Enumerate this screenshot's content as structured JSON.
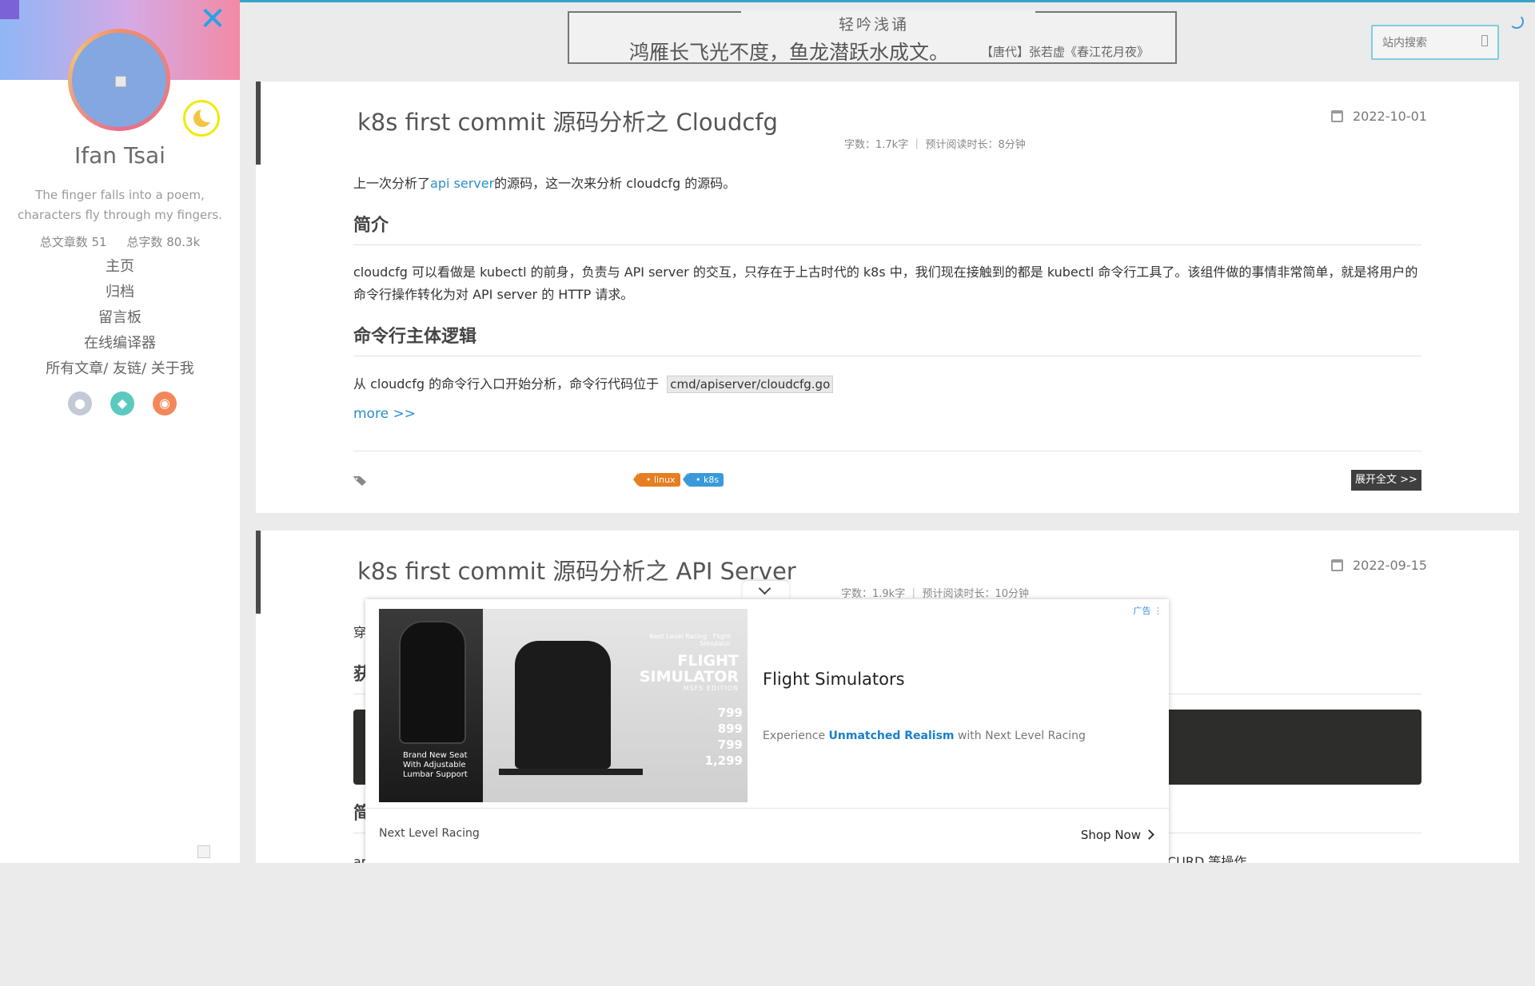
{
  "sidebar": {
    "author": "Ifan Tsai",
    "motto": "The finger falls into a poem, characters fly through my fingers.",
    "stats": {
      "articles_label": "总文章数",
      "articles_value": "51",
      "words_label": "总字数",
      "words_value": "80.3k"
    },
    "nav": [
      "主页",
      "归档",
      "留言板",
      "在线编译器",
      "所有文章/ 友链/ 关于我"
    ],
    "socials": [
      "github-icon",
      "qq-icon",
      "rss-icon"
    ],
    "colors": {
      "banner_start": "#8fb6f5",
      "banner_end": "#f28aa5",
      "close": "#23a4e6",
      "moon_ring": "#f4e80a"
    }
  },
  "poem": {
    "title": "轻吟浅诵",
    "line": "鸿雁长飞光不度，鱼龙潜跃水成文。",
    "source": "【唐代】张若虚《春江花月夜》"
  },
  "search": {
    "placeholder": "站内搜索"
  },
  "posts": [
    {
      "title": "k8s first commit 源码分析之 Cloudcfg",
      "date": "2022-10-01",
      "meta": "字数：1.7k字 ｜ 预计阅读时长：8分钟",
      "intro_before": "上一次分析了",
      "intro_link": "api server",
      "intro_after": "的源码，这一次来分析 cloudcfg 的源码。",
      "h_intro": "简介",
      "p_intro": "cloudcfg 可以看做是 kubectl 的前身，负责与 API server 的交互，只存在于上古时代的 k8s 中，我们现在接触到的都是 kubectl 命令行工具了。该组件做的事情非常简单，就是将用户的命令行操作转化为对 API server 的 HTTP 请求。",
      "h_cli": "命令行主体逻辑",
      "p_cli": "从 cloudcfg 的命令行入口开始分析，命令行代码位于",
      "code_path": "cmd/apiserver/cloudcfg.go",
      "more": "more >>",
      "tags": [
        "linux",
        "k8s"
      ],
      "expand": "展开全文 >>"
    },
    {
      "title": "k8s first commit 源码分析之 API Server",
      "date": "2022-09-15",
      "meta": "字数：1.9k字 ｜ 预计阅读时长：10分钟",
      "line1_start": "穿",
      "h1_start": "获",
      "h2_start": "简",
      "line_bottom_start": "ar",
      "line_bottom_end": "CURD 等操作"
    }
  ],
  "ad": {
    "label": "广告",
    "title": "Flight Simulators",
    "desc_before": "Experience ",
    "desc_bold": "Unmatched Realism",
    "desc_after": " with Next Level Racing",
    "advertiser": "Next Level Racing",
    "cta": "Shop Now",
    "image": {
      "left_text_1": "Brand New Seat",
      "left_text_2": "With Adjustable",
      "left_text_3": "Lumbar Support",
      "brand": "Next Level Racing · Flight Simulator",
      "product_1": "FLIGHT",
      "product_2": "SIMULATOR",
      "edition": "MSFS EDITION",
      "prices": [
        "799",
        "899",
        "799",
        "1,299"
      ]
    }
  }
}
